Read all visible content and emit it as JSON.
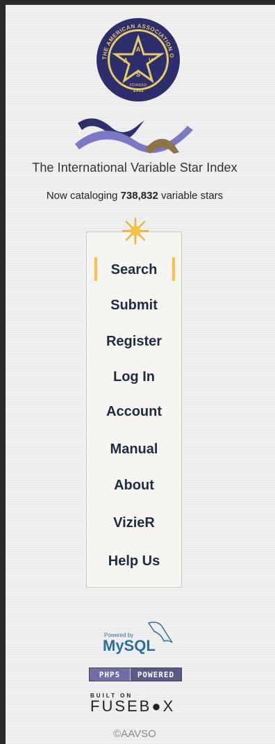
{
  "site": {
    "seal_text": "THE AMERICAN ASSOCIATION OF VARIABLE STAR OBSERVERS",
    "seal_letters": [
      "A",
      "A",
      "V",
      "S",
      "O"
    ],
    "seal_year": "1911",
    "seal_founded": "FOUNDED",
    "title": "The International Variable Star Index",
    "subtitle_prefix": "Now cataloging ",
    "subtitle_count": "738,832",
    "subtitle_suffix": " variable stars"
  },
  "menu": {
    "items": [
      {
        "label": "Search",
        "active": true
      },
      {
        "label": "Submit"
      },
      {
        "label": "Register"
      },
      {
        "label": "Log In"
      },
      {
        "label": "Account"
      },
      {
        "label": "Manual"
      },
      {
        "label": "About"
      },
      {
        "label": "VizieR"
      },
      {
        "label": "Help Us"
      }
    ]
  },
  "footer": {
    "mysql_powered": "Powered by",
    "mysql_name": "MySQL",
    "php_label": "PHP5",
    "php_powered": "POWERED",
    "fusebox_built": "BUILT ON",
    "fusebox_name": "FUSEB●X",
    "copyright": "©AAVSO"
  },
  "colors": {
    "navy": "#2c2f6b",
    "wave_light": "#7b78c4",
    "wave_gold": "#8c7448",
    "accent": "#f2c14e",
    "menu_text": "#1f2a44"
  },
  "icons": [
    "aavso-seal-icon",
    "wave-logo-icon",
    "sun-icon",
    "mysql-dolphin-icon"
  ]
}
